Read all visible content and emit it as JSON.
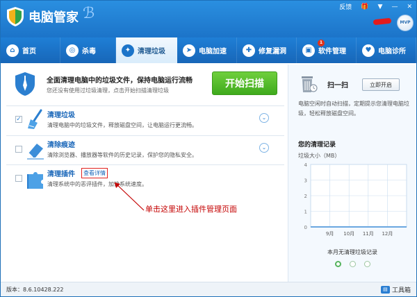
{
  "app": {
    "title": "电脑管家",
    "window_controls": [
      "反馈",
      "🎁",
      "▼",
      "—",
      "✕"
    ],
    "avatar_text": "MVP"
  },
  "tabs": [
    {
      "label": "首页",
      "icon": "home-icon",
      "glyph": "⌂",
      "active": false
    },
    {
      "label": "杀毒",
      "icon": "antivirus-icon",
      "glyph": "◎",
      "active": false
    },
    {
      "label": "清理垃圾",
      "icon": "broom-icon",
      "glyph": "✦",
      "active": true
    },
    {
      "label": "电脑加速",
      "icon": "rocket-icon",
      "glyph": "➤",
      "active": false
    },
    {
      "label": "修复漏洞",
      "icon": "patch-icon",
      "glyph": "✚",
      "active": false
    },
    {
      "label": "软件管理",
      "icon": "software-icon",
      "glyph": "▣",
      "active": false,
      "badge": "1"
    },
    {
      "label": "电脑诊所",
      "icon": "clinic-icon",
      "glyph": "♥",
      "active": false
    }
  ],
  "banner": {
    "title": "全面清理电脑中的垃圾文件，保持电脑运行流畅",
    "subtitle": "您还没有使用过垃圾清理，点击开始扫描清理垃圾",
    "scan_button": "开始扫描"
  },
  "items": [
    {
      "title": "清理垃圾",
      "desc": "清理电脑中的垃圾文件，释放磁盘空间，让电脑运行更流畅。",
      "checked": true,
      "icon": "broom-icon"
    },
    {
      "title": "清除痕迹",
      "desc": "清除浏览器、播放器等软件的历史记录，保护您的隐私安全。",
      "checked": false,
      "icon": "eraser-icon"
    },
    {
      "title": "清理插件",
      "desc": "清理系统中的恶评插件，加快系统速度。",
      "checked": false,
      "icon": "plugin-icon",
      "link": "查看详情"
    }
  ],
  "annotation": "单击这里进入插件管理页面",
  "right_panel": {
    "title": "扫一扫",
    "button": "立即开启",
    "desc": "电脑空闲时自动扫描，定期提示您清理电脑垃圾，轻松释放磁盘空间。",
    "record_title": "您的清理记录",
    "unit_label": "垃圾大小（MB）",
    "empty_text": "本月无清理垃圾记录"
  },
  "chart_data": {
    "type": "line",
    "ylabel": "垃圾大小（MB）",
    "y_ticks": [
      "4",
      "3",
      "2",
      "1",
      "0"
    ],
    "ylim": [
      0,
      4
    ],
    "categories": [
      "9月",
      "10月",
      "11月",
      "12月"
    ],
    "values": [
      0,
      0,
      0,
      0
    ],
    "grid": true,
    "colors": {
      "grid": "#c9dcef",
      "line": "#6aa7e0"
    }
  },
  "pager": {
    "count": 3,
    "active": 0
  },
  "status": {
    "version": "版本：8.6.10428.222",
    "toolbox": "工具箱"
  }
}
